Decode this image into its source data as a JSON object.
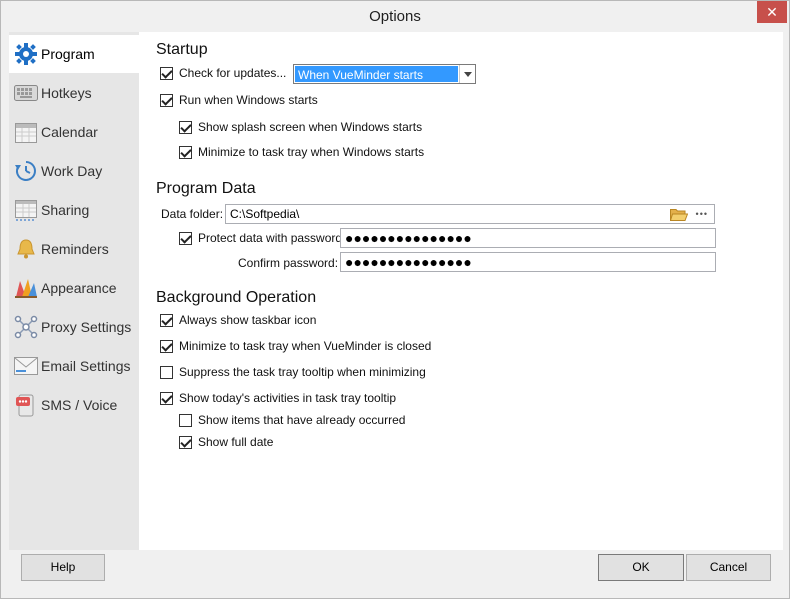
{
  "window": {
    "title": "Options",
    "close": "✕"
  },
  "sidebar": {
    "items": [
      {
        "label": "Program"
      },
      {
        "label": "Hotkeys"
      },
      {
        "label": "Calendar"
      },
      {
        "label": "Work Day"
      },
      {
        "label": "Sharing"
      },
      {
        "label": "Reminders"
      },
      {
        "label": "Appearance"
      },
      {
        "label": "Proxy Settings"
      },
      {
        "label": "Email Settings"
      },
      {
        "label": "SMS / Voice"
      }
    ]
  },
  "startup": {
    "title": "Startup",
    "check_updates": "Check for updates...",
    "check_updates_value": "When VueMinder starts",
    "run_windows": "Run when Windows starts",
    "splash": "Show splash screen when Windows starts",
    "minimize_tray": "Minimize to task tray when Windows starts"
  },
  "program_data": {
    "title": "Program Data",
    "folder_label": "Data folder:",
    "folder_value": "C:\\Softpedia\\",
    "more": "•••",
    "protect_label": "Protect data with password:",
    "password_mask": "●●●●●●●●●●●●●●●",
    "confirm_label": "Confirm password:",
    "confirm_mask": "●●●●●●●●●●●●●●●"
  },
  "background": {
    "title": "Background Operation",
    "taskbar_icon": "Always show taskbar icon",
    "minimize_closed": "Minimize to task tray when VueMinder is closed",
    "suppress_tooltip": "Suppress the task tray tooltip when minimizing",
    "show_activities": "Show today's activities in task tray tooltip",
    "show_occurred": "Show items that have already occurred",
    "show_full_date": "Show full date"
  },
  "footer": {
    "help": "Help",
    "ok": "OK",
    "cancel": "Cancel"
  }
}
